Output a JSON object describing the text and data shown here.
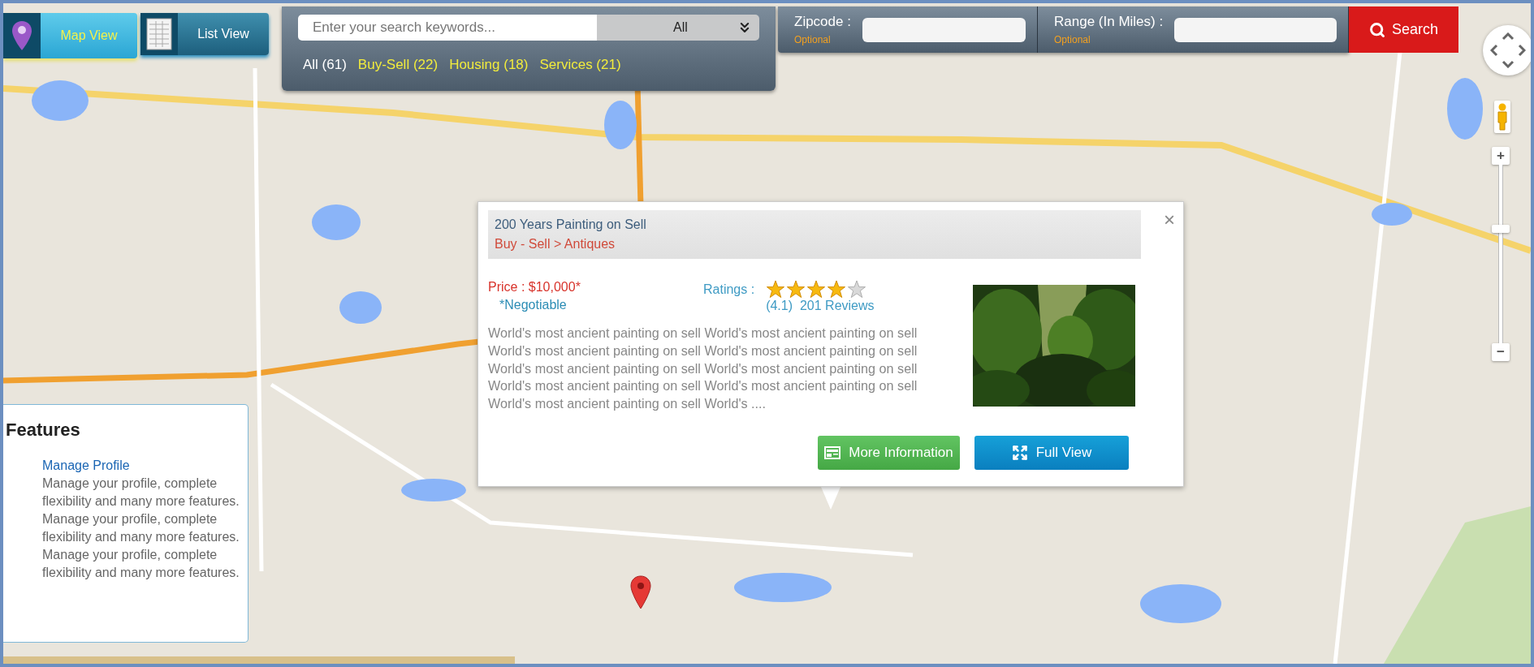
{
  "view_toggle": [
    {
      "kind": "map",
      "label": "Map View",
      "selected": true
    },
    {
      "kind": "list",
      "label": "List View",
      "selected": false
    }
  ],
  "search": {
    "placeholder": "Enter your search keywords...",
    "category": "All"
  },
  "filters": [
    {
      "label": "All (61)",
      "selected": true
    },
    {
      "label": "Buy-Sell (22)",
      "selected": false
    },
    {
      "label": "Housing (18)",
      "selected": false
    },
    {
      "label": "Services (21)",
      "selected": false
    }
  ],
  "location_fields": [
    {
      "label": "Zipcode :",
      "hint": "Optional"
    },
    {
      "label": "Range (In Miles) :",
      "hint": "Optional"
    }
  ],
  "search_button": "Search",
  "map_controls": {
    "zoom_in": "+",
    "zoom_out": "−",
    "zoom": {
      "level": 0.65
    }
  },
  "popup": {
    "close": "×",
    "title": "200 Years Painting on Sell",
    "category": "Buy - Sell > Antiques",
    "price": "Price : $10,000*",
    "note": "*Negotiable",
    "ratings_label": "Ratings :",
    "stars": 4,
    "reviews": "(4.1)  201 Reviews",
    "description": "World's most ancient painting on sell World's most ancient painting on sell World's most ancient painting on sell World's most ancient painting on sell World's most ancient painting on sell World's most ancient painting on sell World's most ancient painting on sell World's most ancient painting on sell World's most ancient painting on sell World's ....",
    "buttons": [
      {
        "kind": "info",
        "label": "More Information"
      },
      {
        "kind": "full",
        "label": "Full View"
      }
    ]
  },
  "features": {
    "title": "Features",
    "items": [
      {
        "title": "Manage Profile",
        "text": "Manage your profile, complete flexibility and many more features. Manage your profile, complete flexibility and many more features. Manage your profile, complete flexibility and many more features."
      }
    ]
  }
}
